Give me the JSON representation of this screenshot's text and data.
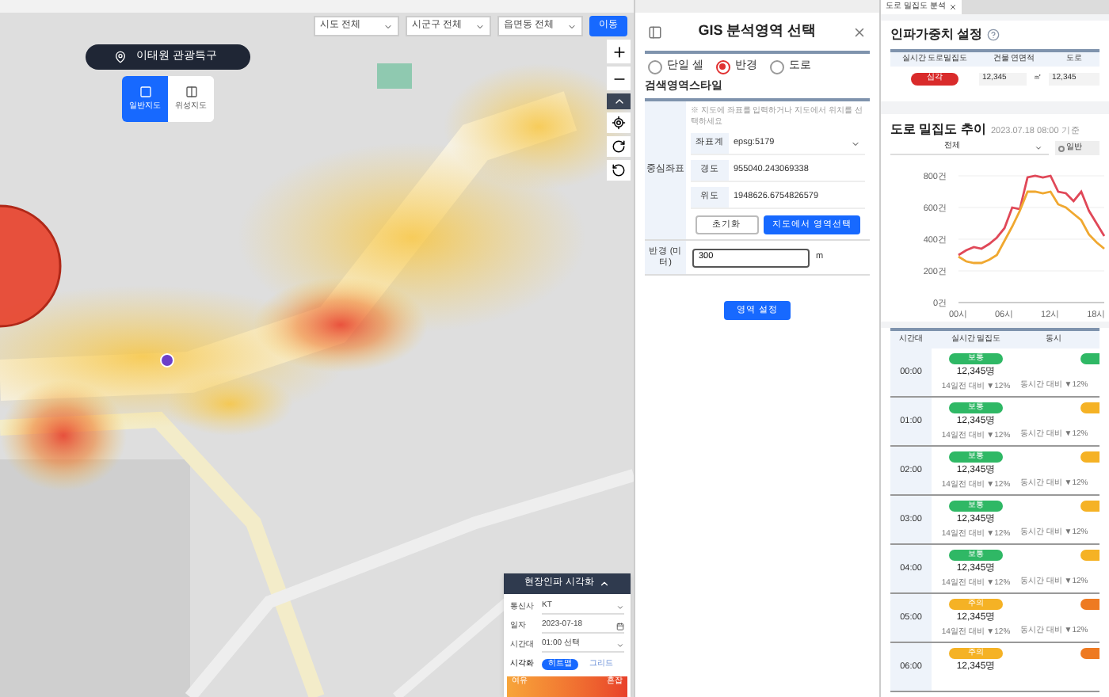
{
  "map": {
    "filters": [
      {
        "label": "시도 전체"
      },
      {
        "label": "시군구 전체"
      },
      {
        "label": "읍면동 전체"
      }
    ],
    "go_button": "이동",
    "location": "이태원 관광특구",
    "view_modes": [
      {
        "label": "일반지도",
        "selected": true
      },
      {
        "label": "위성지도",
        "selected": false
      }
    ],
    "viz_panel": {
      "title": "현장인파 시각화",
      "fields": [
        {
          "label": "통신사",
          "value": "KT",
          "kind": "select"
        },
        {
          "label": "일자",
          "value": "2023-07-18",
          "kind": "date"
        },
        {
          "label": "시간대",
          "value": "01:00 선택",
          "kind": "select"
        }
      ],
      "mode_label": "시각화",
      "modes": [
        {
          "label": "히트맵",
          "selected": true
        },
        {
          "label": "그리드",
          "selected": false
        }
      ],
      "legend_low": "여유",
      "legend_high": "혼잡"
    }
  },
  "gis_panel": {
    "title": "GIS 분석영역 선택",
    "area_types": [
      {
        "label": "단일 셀",
        "selected": false
      },
      {
        "label": "반경",
        "selected": true
      },
      {
        "label": "도로",
        "selected": false
      }
    ],
    "section_title": "검색영역스타일",
    "center_label": "중심좌표",
    "note": "※ 지도에 좌표를 입력하거나 지도에서 위치를 선택하세요",
    "fields": [
      {
        "label": "좌표계",
        "value": "epsg:5179",
        "kind": "select"
      },
      {
        "label": "경도",
        "value": "955040.243069338",
        "kind": "text"
      },
      {
        "label": "위도",
        "value": "1948626.6754826579",
        "kind": "text"
      }
    ],
    "reset_button": "초기화",
    "pick_button": "지도에서 영역선택",
    "radius_label": "반경 (미터)",
    "radius_value": "300",
    "radius_unit": "m",
    "apply_button": "영역 설정"
  },
  "right_panel": {
    "tab": "도로 밀집도 분석",
    "weight_title": "인파가중치 설정",
    "weight_columns": [
      "실시간 도로밀집도",
      "건물 연면적",
      "도로"
    ],
    "weight_row": {
      "status": {
        "label": "심각",
        "color": "#d92b2b"
      },
      "area": "12,345",
      "area_unit": "㎡",
      "road": "12,345"
    },
    "trend_title": "도로 밀집도 추이",
    "trend_time": "2023.07.18 08:00 기준",
    "trend_select": "전체",
    "trend_radio": "일반",
    "chart_data": {
      "type": "line",
      "grid": true,
      "xlim": [
        0,
        19
      ],
      "x": [
        0,
        1,
        2,
        3,
        4,
        5,
        6,
        7,
        8,
        9,
        10,
        11,
        12,
        13,
        14,
        15,
        16,
        17,
        18,
        19
      ],
      "yticks": [
        {
          "value": 0,
          "label": "0건"
        },
        {
          "value": 200,
          "label": "200건"
        },
        {
          "value": 400,
          "label": "400건"
        },
        {
          "value": 600,
          "label": "600건"
        },
        {
          "value": 800,
          "label": "800건"
        }
      ],
      "xticks": [
        {
          "value": 0,
          "label": "00시"
        },
        {
          "value": 6,
          "label": "06시"
        },
        {
          "value": 12,
          "label": "12시"
        },
        {
          "value": 18,
          "label": "18시"
        }
      ],
      "ylim": [
        0,
        800
      ],
      "series": [
        {
          "color": "#e04858",
          "values": [
            300,
            330,
            350,
            340,
            370,
            410,
            470,
            600,
            590,
            790,
            800,
            790,
            800,
            700,
            690,
            640,
            700,
            580,
            500,
            420
          ]
        },
        {
          "color": "#f0a830",
          "values": [
            290,
            260,
            250,
            250,
            270,
            300,
            390,
            480,
            580,
            700,
            700,
            690,
            700,
            620,
            600,
            560,
            520,
            430,
            380,
            340
          ]
        }
      ]
    },
    "table_columns": [
      "시간대",
      "실시간 밀집도",
      "동시"
    ],
    "rows": [
      {
        "time": "00:00",
        "status": {
          "label": "보통",
          "color": "#2fb865"
        },
        "value": "12,345명",
        "change": "14일전 대비 ▼12%",
        "compare": {
          "text": "동시간 대비 ▼12%",
          "color": "#2fb865"
        }
      },
      {
        "time": "01:00",
        "status": {
          "label": "보통",
          "color": "#2fb865"
        },
        "value": "12,345명",
        "change": "14일전 대비 ▼12%",
        "compare": {
          "text": "동시간 대비 ▼12%",
          "color": "#f5b225"
        }
      },
      {
        "time": "02:00",
        "status": {
          "label": "보통",
          "color": "#2fb865"
        },
        "value": "12,345명",
        "change": "14일전 대비 ▼12%",
        "compare": {
          "text": "동시간 대비 ▼12%",
          "color": "#f5b225"
        }
      },
      {
        "time": "03:00",
        "status": {
          "label": "보통",
          "color": "#2fb865"
        },
        "value": "12,345명",
        "change": "14일전 대비 ▼12%",
        "compare": {
          "text": "동시간 대비 ▼12%",
          "color": "#f5b225"
        }
      },
      {
        "time": "04:00",
        "status": {
          "label": "보통",
          "color": "#2fb865"
        },
        "value": "12,345명",
        "change": "14일전 대비 ▼12%",
        "compare": {
          "text": "동시간 대비 ▼12%",
          "color": "#f5b225"
        }
      },
      {
        "time": "05:00",
        "status": {
          "label": "주의",
          "color": "#f5b225"
        },
        "value": "12,345명",
        "change": "14일전 대비 ▼12%",
        "compare": {
          "text": "동시간 대비 ▼12%",
          "color": "#ee7a22"
        }
      },
      {
        "time": "06:00",
        "status": {
          "label": "주의",
          "color": "#f5b225"
        },
        "value": "12,345명",
        "compare": {
          "color": "#ee7a22"
        }
      }
    ]
  }
}
